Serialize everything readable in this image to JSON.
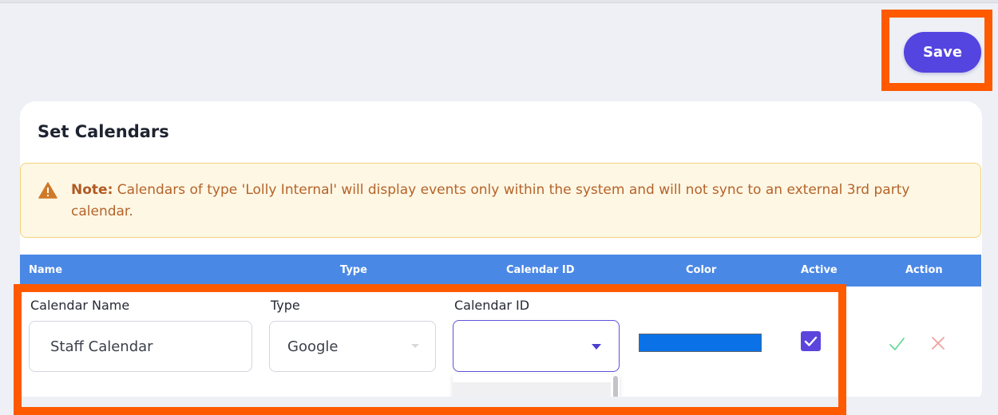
{
  "header": {
    "save_label": "Save"
  },
  "section": {
    "title": "Set Calendars"
  },
  "note": {
    "label": "Note:",
    "text": " Calendars of type 'Lolly Internal' will display events only within the system and will not sync to an external 3rd party calendar."
  },
  "table": {
    "columns": [
      "Name",
      "Type",
      "Calendar ID",
      "Color",
      "Active",
      "Action"
    ]
  },
  "row": {
    "name_label": "Calendar Name",
    "name_value": "Staff Calendar",
    "type_label": "Type",
    "type_value": "Google",
    "calendar_id_label": "Calendar ID",
    "calendar_id_value": "",
    "color": "#0a72e6",
    "active": true
  },
  "colors": {
    "accent": "#5444e0",
    "table_header": "#4a88e6",
    "highlight": "#ff5a00",
    "warning_text": "#b5632a",
    "confirm": "#66d99a",
    "cancel": "#f2a0a0"
  }
}
